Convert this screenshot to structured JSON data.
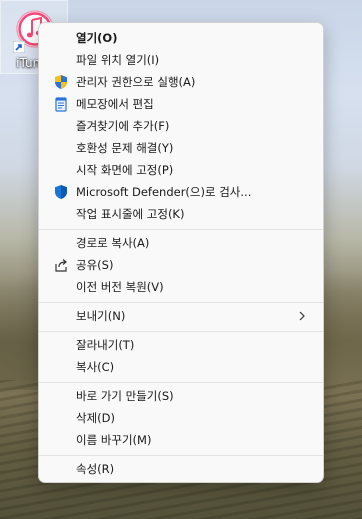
{
  "desktop": {
    "icon_label": "iTunes"
  },
  "context_menu": {
    "items": [
      {
        "label": "열기(O)",
        "icon": "none"
      },
      {
        "label": "파일 위치 열기(I)",
        "icon": "none"
      },
      {
        "label": "관리자 권한으로 실행(A)",
        "icon": "uac-shield-icon"
      },
      {
        "label": "메모장에서 편집",
        "icon": "notepad-icon"
      },
      {
        "label": "즐겨찾기에 추가(F)",
        "icon": "none"
      },
      {
        "label": "호환성 문제 해결(Y)",
        "icon": "none"
      },
      {
        "label": "시작 화면에 고정(P)",
        "icon": "none"
      },
      {
        "label": "Microsoft Defender(으)로 검사...",
        "icon": "defender-shield-icon"
      },
      {
        "label": "작업 표시줄에 고정(K)",
        "icon": "none"
      },
      {
        "label": "경로로 복사(A)",
        "icon": "none"
      },
      {
        "label": "공유(S)",
        "icon": "share-icon"
      },
      {
        "label": "이전 버전 복원(V)",
        "icon": "none"
      },
      {
        "label": "보내기(N)",
        "icon": "chevron-right-icon"
      },
      {
        "label": "잘라내기(T)",
        "icon": "none"
      },
      {
        "label": "복사(C)",
        "icon": "none"
      },
      {
        "label": "바로 가기 만들기(S)",
        "icon": "none"
      },
      {
        "label": "삭제(D)",
        "icon": "none"
      },
      {
        "label": "이름 바꾸기(M)",
        "icon": "none"
      },
      {
        "label": "속성(R)",
        "icon": "none"
      }
    ]
  },
  "colors": {
    "menu_background": "#f9f9f9",
    "separator": "#e3e3e3",
    "defender_blue": "#1976d2",
    "uac_blue": "#2f6fd8",
    "uac_yellow": "#f2c21b",
    "itunes_pink": "#f6497a"
  }
}
